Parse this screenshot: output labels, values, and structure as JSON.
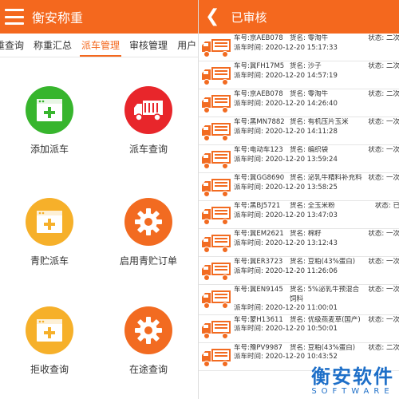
{
  "left_screen": {
    "header_title": "衡安称重",
    "tabs": [
      {
        "label": "重查询",
        "active": false
      },
      {
        "label": "称重汇总",
        "active": false
      },
      {
        "label": "派车管理",
        "active": true
      },
      {
        "label": "审核管理",
        "active": false
      },
      {
        "label": "用户",
        "active": false
      }
    ],
    "menu": [
      {
        "label": "添加派车",
        "icon": "add-window-icon",
        "color": "#37b52d"
      },
      {
        "label": "派车查询",
        "icon": "truck-icon",
        "color": "#e8262b"
      },
      {
        "label": "青贮派车",
        "icon": "add-window-icon",
        "color": "#f6b02a"
      },
      {
        "label": "启用青贮订单",
        "icon": "gear-icon",
        "color": "#f26b21"
      },
      {
        "label": "拒收查询",
        "icon": "add-window-icon",
        "color": "#f6b02a"
      },
      {
        "label": "在途查询",
        "icon": "gear-icon",
        "color": "#f26b21"
      }
    ]
  },
  "right_screen": {
    "header_title": "已审核",
    "labels": {
      "plate": "车号:",
      "goods": "货名:",
      "status": "状态:",
      "time": "派车时间:"
    },
    "records": [
      {
        "plate": "京AEB078",
        "goods": "零淘牛",
        "status": "二次",
        "time": "2020-12-20 15:17:33"
      },
      {
        "plate": "冀FH17M5",
        "goods": "沙子",
        "status": "二次",
        "time": "2020-12-20 14:57:19"
      },
      {
        "plate": "京AEB078",
        "goods": "零淘牛",
        "status": "二次",
        "time": "2020-12-20 14:26:40"
      },
      {
        "plate": "黑MN7882",
        "goods": "有机压片玉米",
        "status": "一次",
        "time": "2020-12-20 14:11:28"
      },
      {
        "plate": "电动车123",
        "goods": "编织袋",
        "status": "一次",
        "time": "2020-12-20 13:59:24"
      },
      {
        "plate": "冀GG8690",
        "goods": "泌乳牛精料补充料",
        "status": "一次",
        "time": "2020-12-20 13:58:25"
      },
      {
        "plate": "黑BJ5721",
        "goods": "全玉米粉",
        "status": "已",
        "time": "2020-12-20 13:47:03"
      },
      {
        "plate": "冀EM2621",
        "goods": "棉籽",
        "status": "一次",
        "time": "2020-12-20 13:12:43"
      },
      {
        "plate": "冀ER3723",
        "goods": "豆粕(43%蛋白)",
        "status": "一次",
        "time": "2020-12-20 11:26:06"
      },
      {
        "plate": "冀EN9145",
        "goods": "5%泌乳牛预混合饲料",
        "status": "一次",
        "time": "2020-12-20 11:00:01"
      },
      {
        "plate": "蒙H13611",
        "goods": "优级燕麦草(国产)",
        "status": "一次",
        "time": "2020-12-20 10:50:01"
      },
      {
        "plate": "豫PV9987",
        "goods": "豆粕(43%蛋白)",
        "status": "二次",
        "time": "2020-12-20 10:43:52"
      }
    ]
  },
  "watermark": {
    "text": "衡安软件",
    "sub": "SOFTWARE"
  },
  "colors": {
    "accent": "#f4681e",
    "truck_icon": "#f26b21"
  }
}
